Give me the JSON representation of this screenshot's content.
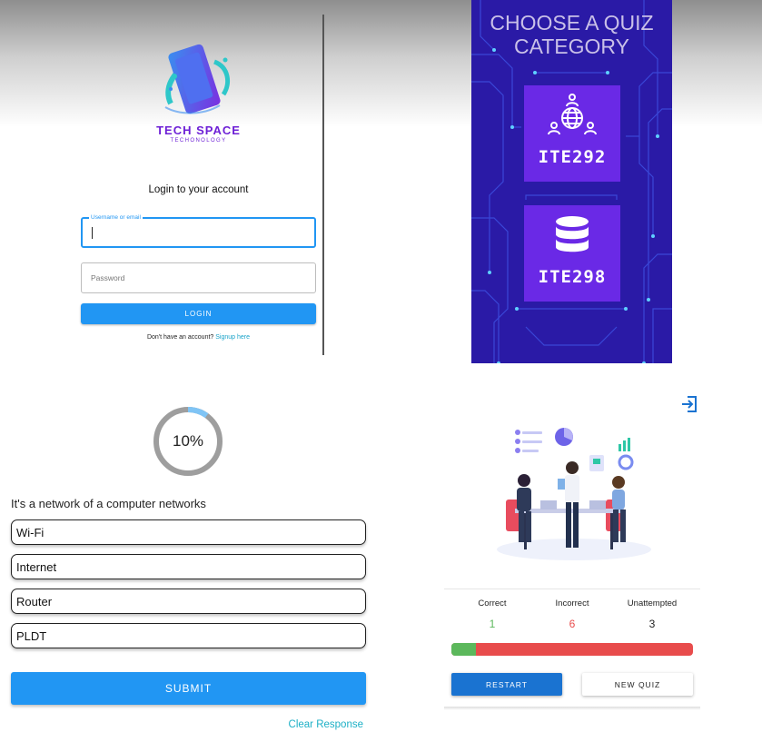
{
  "colors": {
    "primary": "#2196f3",
    "brand": "#6d1fd6",
    "correct": "#5cb85c",
    "incorrect": "#e84c4c",
    "link": "#1aa3c9",
    "category_bg": "#2b1aa8",
    "card": "#6a29e6"
  },
  "login": {
    "brand_name": "TECH SPACE",
    "brand_tagline": "TECHONOLOGY",
    "title": "Login to your account",
    "username_label": "Username or email",
    "password_placeholder": "Password",
    "login_button": "LOGIN",
    "signup_prompt": "Don't have an account?",
    "signup_link": "Signup here"
  },
  "category": {
    "title_line1": "CHOOSE A QUIZ",
    "title_line2": "CATEGORY",
    "cards": [
      {
        "label": "ITE292",
        "icon": "globe-network-icon"
      },
      {
        "label": "ITE298",
        "icon": "database-icon"
      }
    ]
  },
  "quiz": {
    "progress_percent": 10,
    "progress_text": "10%",
    "question": "It's a network of a computer networks",
    "options": [
      "Wi-Fi",
      "Internet",
      "Router",
      "PLDT"
    ],
    "submit_button": "SUBMIT",
    "clear_link": "Clear Response"
  },
  "result": {
    "exit_icon": "exit-icon",
    "correct_label": "Correct",
    "incorrect_label": "Incorrect",
    "unattempted_label": "Unattempted",
    "correct_count": "1",
    "incorrect_count": "6",
    "unattempted_count": "3",
    "correct_fraction": 0.1,
    "restart_button": "RESTART",
    "new_quiz_button": "NEW QUIZ"
  }
}
